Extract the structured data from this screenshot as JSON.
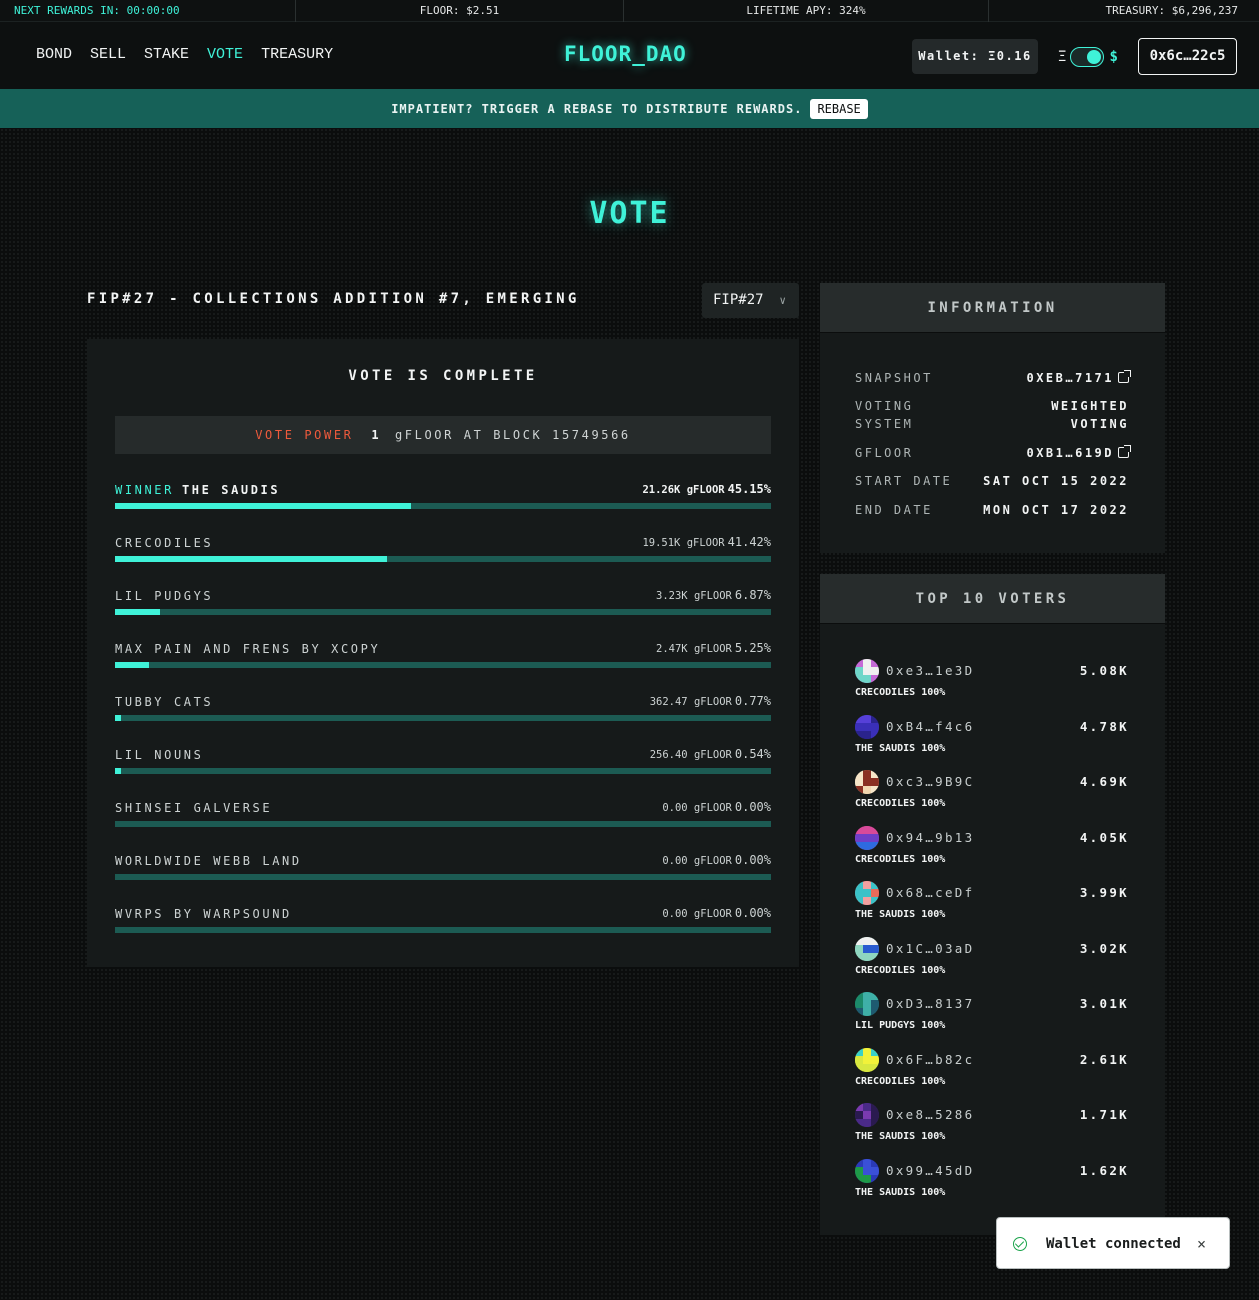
{
  "ticker": {
    "next_rewards": "NEXT REWARDS IN: 00:00:00",
    "floor": "FLOOR: $2.51",
    "apy": "LIFETIME APY: 324%",
    "treasury": "TREASURY: $6,296,237"
  },
  "nav": {
    "items": [
      {
        "label": "BOND"
      },
      {
        "label": "SELL"
      },
      {
        "label": "STAKE"
      },
      {
        "label": "VOTE",
        "active": true
      },
      {
        "label": "TREASURY"
      }
    ],
    "logo": "FLOOR_DAO",
    "wallet": "Wallet: Ξ0.16",
    "toggle_left": "Ξ",
    "toggle_right": "$",
    "address": "0x6c…22c5"
  },
  "banner": {
    "text": "IMPATIENT? TRIGGER A REBASE TO DISTRIBUTE REWARDS.",
    "button": "REBASE"
  },
  "page_title": "VOTE",
  "proposal": {
    "title": "FIP#27 - COLLECTIONS ADDITION #7, EMERGING",
    "selected": "FIP#27"
  },
  "results": {
    "status": "VOTE IS COMPLETE",
    "vote_power_label": "VOTE POWER",
    "vote_power_value": "1",
    "vote_power_suffix": "gFLOOR AT BLOCK 15749566",
    "winner_label": "WINNER",
    "choices": [
      {
        "name": "THE SAUDIS",
        "amount": "21.26K gFLOOR",
        "percent": "45.15%",
        "fraction": 0.4515,
        "winner": true
      },
      {
        "name": "CRECODILES",
        "amount": "19.51K gFLOOR",
        "percent": "41.42%",
        "fraction": 0.4142
      },
      {
        "name": "LIL PUDGYS",
        "amount": "3.23K gFLOOR",
        "percent": "6.87%",
        "fraction": 0.0687
      },
      {
        "name": "MAX PAIN AND FRENS BY XCOPY",
        "amount": "2.47K gFLOOR",
        "percent": "5.25%",
        "fraction": 0.0525
      },
      {
        "name": "TUBBY CATS",
        "amount": "362.47 gFLOOR",
        "percent": "0.77%",
        "fraction": 0.0077
      },
      {
        "name": "LIL NOUNS",
        "amount": "256.40 gFLOOR",
        "percent": "0.54%",
        "fraction": 0.0054
      },
      {
        "name": "SHINSEI GALVERSE",
        "amount": "0.00 gFLOOR",
        "percent": "0.00%",
        "fraction": 0
      },
      {
        "name": "WORLDWIDE WEBB LAND",
        "amount": "0.00 gFLOOR",
        "percent": "0.00%",
        "fraction": 0
      },
      {
        "name": "WVRPS BY WARPSOUND",
        "amount": "0.00 gFLOOR",
        "percent": "0.00%",
        "fraction": 0
      }
    ]
  },
  "information": {
    "title": "INFORMATION",
    "rows": [
      {
        "key": "SNAPSHOT",
        "value": "0XEB…7171",
        "link": true
      },
      {
        "key": "VOTING\nSYSTEM",
        "value": "WEIGHTED\nVOTING"
      },
      {
        "key": "GFLOOR",
        "value": "0XB1…619D",
        "link": true
      },
      {
        "key": "START DATE",
        "value": "SAT OCT 15 2022"
      },
      {
        "key": "END DATE",
        "value": "MON OCT 17 2022"
      }
    ]
  },
  "top_voters": {
    "title": "TOP 10 VOTERS",
    "voters": [
      {
        "address": "0xe3…1e3D",
        "amount": "5.08K",
        "choice": "CRECODILES 100%",
        "colors": [
          "#c56ad6",
          "#6fd6c9",
          "#f0f0f0"
        ]
      },
      {
        "address": "0xB4…f4c6",
        "amount": "4.78K",
        "choice": "THE SAUDIS 100%",
        "colors": [
          "#3a2fb8",
          "#5640d8",
          "#2a238c"
        ]
      },
      {
        "address": "0xc3…9B9C",
        "amount": "4.69K",
        "choice": "CRECODILES 100%",
        "colors": [
          "#f2d7b0",
          "#8a2f22",
          "#f6e5c8"
        ]
      },
      {
        "address": "0x94…9b13",
        "amount": "4.05K",
        "choice": "CRECODILES 100%",
        "colors": [
          "#d84a9a",
          "#2e6be0",
          "#6f3fc8"
        ]
      },
      {
        "address": "0x68…ceDf",
        "amount": "3.99K",
        "choice": "THE SAUDIS 100%",
        "colors": [
          "#e86a5a",
          "#3ac2c8",
          "#f2a0a0"
        ]
      },
      {
        "address": "0x1C…03aD",
        "amount": "3.02K",
        "choice": "CRECODILES 100%",
        "colors": [
          "#8fd6c0",
          "#2a5bd0",
          "#f0f0f0"
        ]
      },
      {
        "address": "0xD3…8137",
        "amount": "3.01K",
        "choice": "LIL PUDGYS 100%",
        "colors": [
          "#1c8a6a",
          "#3fb0a8",
          "#1e5a70"
        ]
      },
      {
        "address": "0x6F…b82c",
        "amount": "2.61K",
        "choice": "CRECODILES 100%",
        "colors": [
          "#f2f23a",
          "#3ad0c8",
          "#d8e840"
        ]
      },
      {
        "address": "0xe8…5286",
        "amount": "1.71K",
        "choice": "THE SAUDIS 100%",
        "colors": [
          "#4a2a88",
          "#2a1a50",
          "#7a3ab0"
        ]
      },
      {
        "address": "0x99…45dD",
        "amount": "1.62K",
        "choice": "THE SAUDIS 100%",
        "colors": [
          "#2a3ab8",
          "#1e9a48",
          "#3a50d8"
        ]
      }
    ]
  },
  "toast": {
    "message": "Wallet connected",
    "close": "×"
  },
  "colors": {
    "accent": "#3ff2d8",
    "banner": "#166158",
    "vote_power": "#ee5a3c",
    "track": "#1c5b53"
  }
}
